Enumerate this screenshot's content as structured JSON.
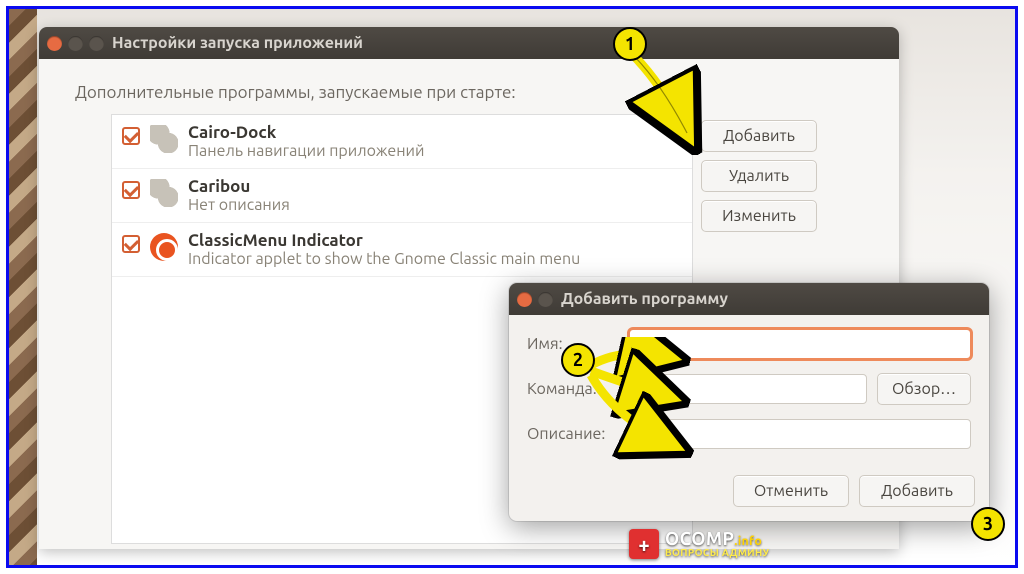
{
  "mainWindow": {
    "title": "Настройки запуска приложений",
    "sectionLabel": "Дополнительные программы, запускаемые при старте:",
    "buttons": {
      "add": "Добавить",
      "remove": "Удалить",
      "edit": "Изменить"
    },
    "items": [
      {
        "title": "Cairo-Dock",
        "desc": "Панель навигации приложений",
        "iconName": "gears-icon"
      },
      {
        "title": "Caribou",
        "desc": "Нет описания",
        "iconName": "gears-icon"
      },
      {
        "title": "ClassicMenu Indicator",
        "desc": "Indicator applet to show the Gnome Classic main menu",
        "iconName": "ubuntu-icon"
      }
    ]
  },
  "dialog": {
    "title": "Добавить программу",
    "fields": {
      "name": "Имя:",
      "command": "Команда:",
      "description": "Описание:"
    },
    "browse": "Обзор…",
    "cancel": "Отменить",
    "add": "Добавить"
  },
  "callouts": {
    "c1": "1",
    "c2": "2",
    "c3": "3"
  },
  "watermark": {
    "domain": "OCOMP",
    "tld": ".info",
    "sub": "ВОПРОСЫ АДМИНУ"
  }
}
